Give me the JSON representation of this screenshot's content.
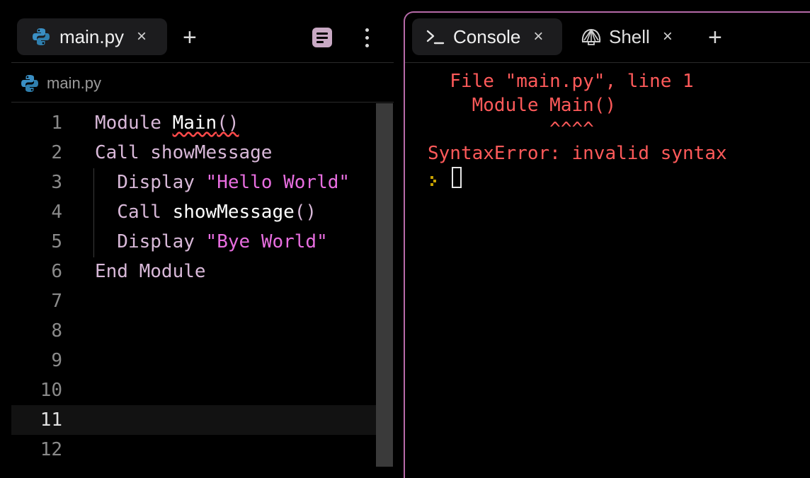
{
  "editor_tabs": [
    {
      "label": "main.py",
      "close": "×",
      "icon": "python-icon",
      "active": true
    }
  ],
  "add_tab": "+",
  "breadcrumb": {
    "file": "main.py",
    "icon": "python-icon"
  },
  "code_lines": [
    {
      "num": "1",
      "parts": [
        {
          "t": "Module ",
          "c": "kw"
        },
        {
          "t": "Main",
          "c": "fn err"
        },
        {
          "t": "()",
          "c": "kw err"
        }
      ]
    },
    {
      "num": "2",
      "parts": [
        {
          "t": "Call showMessage",
          "c": "kw"
        }
      ]
    },
    {
      "num": "3",
      "parts": [
        {
          "t": "  Display ",
          "c": "kw"
        },
        {
          "t": "\"Hello World\"",
          "c": "str"
        }
      ]
    },
    {
      "num": "4",
      "parts": [
        {
          "t": "  Call ",
          "c": "kw"
        },
        {
          "t": "showMessage",
          "c": "fn"
        },
        {
          "t": "()",
          "c": "kw"
        }
      ]
    },
    {
      "num": "5",
      "parts": [
        {
          "t": "  Display ",
          "c": "kw"
        },
        {
          "t": "\"Bye World\"",
          "c": "str"
        }
      ]
    },
    {
      "num": "6",
      "parts": [
        {
          "t": "End Module",
          "c": "kw"
        }
      ]
    },
    {
      "num": "7",
      "parts": []
    },
    {
      "num": "8",
      "parts": []
    },
    {
      "num": "9",
      "parts": []
    },
    {
      "num": "10",
      "parts": []
    },
    {
      "num": "11",
      "parts": [],
      "current": true
    },
    {
      "num": "12",
      "parts": []
    }
  ],
  "right_tabs": [
    {
      "label": "Console",
      "close": "×",
      "icon": "terminal-icon",
      "active": true
    },
    {
      "label": "Shell",
      "close": "×",
      "icon": "shell-icon",
      "active": false
    }
  ],
  "console_output": [
    "  File \"main.py\", line 1",
    "    Module Main()",
    "           ^^^^",
    "SyntaxError: invalid syntax"
  ],
  "colors": {
    "accent_border": "#b66aa8",
    "error_text": "#ff5a5a",
    "string": "#e86ee0",
    "keyword": "#d8b8d8"
  }
}
